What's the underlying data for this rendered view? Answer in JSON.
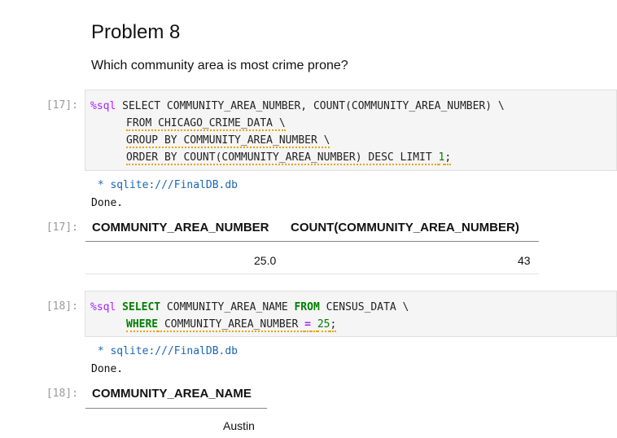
{
  "heading": "Problem 8",
  "question": "Which community area is most crime prone?",
  "cell1": {
    "prompt_in": "[17]:",
    "prompt_out": "[17]:",
    "line1_magic": "%sql",
    "line1_rest": " SELECT COMMUNITY_AREA_NUMBER, COUNT(COMMUNITY_AREA_NUMBER) \\",
    "line2": "FROM CHICAGO_CRIME_DATA \\",
    "line3": "GROUP BY COMMUNITY_AREA_NUMBER \\",
    "line4_a": "ORDER BY COUNT(COMMUNITY_AREA_NUMBER) DESC LIMIT ",
    "line4_num": "1",
    "line4_end": ";",
    "out_connection": " * sqlite:///FinalDB.db",
    "out_done": "Done.",
    "table": {
      "headers": [
        "COMMUNITY_AREA_NUMBER",
        "COUNT(COMMUNITY_AREA_NUMBER)"
      ],
      "rows": [
        [
          "25.0",
          "43"
        ]
      ]
    }
  },
  "cell2": {
    "prompt_in": "[18]:",
    "prompt_out": "[18]:",
    "line1_magic": "%sql",
    "line1_kw1": "SELECT",
    "line1_mid": " COMMUNITY_AREA_NAME ",
    "line1_kw2": "FROM",
    "line1_rest": " CENSUS_DATA \\",
    "line2_kw": "WHERE",
    "line2_mid": " COMMUNITY_AREA_NUMBER ",
    "line2_eq": "=",
    "line2_sp": " ",
    "line2_num": "25",
    "line2_end": ";",
    "out_connection": " * sqlite:///FinalDB.db",
    "out_done": "Done.",
    "table": {
      "headers": [
        "COMMUNITY_AREA_NAME"
      ],
      "rows": [
        [
          "Austin"
        ]
      ]
    }
  }
}
